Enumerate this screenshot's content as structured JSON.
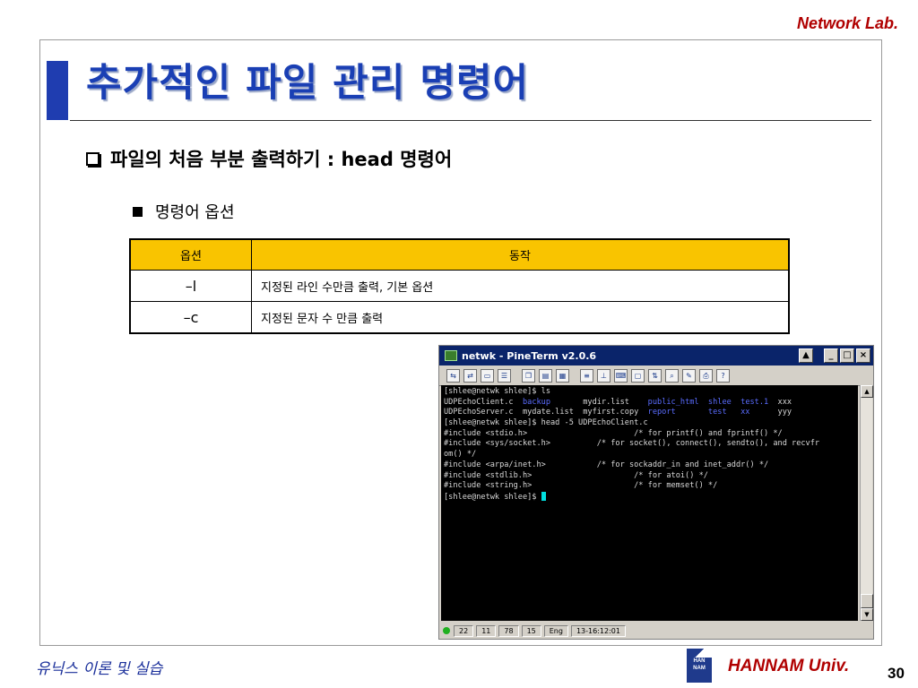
{
  "header": {
    "brand": "Network Lab."
  },
  "slide": {
    "title": "추가적인 파일 관리 명령어",
    "bullet1": "파일의 처음 부분 출력하기 : head 명령어",
    "bullet2": "명령어 옵션"
  },
  "options_table": {
    "headers": [
      "옵션",
      "동작"
    ],
    "rows": [
      {
        "option": "–l",
        "action": "지정된 라인 수만큼 출력, 기본 옵션"
      },
      {
        "option": "–c",
        "action": "지정된 문자 수 만큼 출력"
      }
    ]
  },
  "terminal": {
    "title": "netwk - PineTerm v2.0.6",
    "lines": {
      "l1": "[shlee@netwk shlee]$ ls",
      "l2a": "UDPEchoClient.c  ",
      "l2b": "backup",
      "l2c": "       mydir.list    ",
      "l2d": "public_html  shlee  test.1",
      "l2e": "  xxx",
      "l3a": "UDPEchoServer.c  mydate.list  myfirst.copy  ",
      "l3b": "report       test   xx",
      "l3c": "      yyy",
      "l4": "[shlee@netwk shlee]$ head -5 UDPEchoClient.c",
      "l5": "#include <stdio.h>                       /* for printf() and fprintf() */",
      "l6": "#include <sys/socket.h>          /* for socket(), connect(), sendto(), and recvfr",
      "l7": "om() */",
      "l8": "#include <arpa/inet.h>           /* for sockaddr_in and inet_addr() */",
      "l9": "#include <stdlib.h>                      /* for atoi() */",
      "l10": "#include <string.h>                      /* for memset() */",
      "l11": "[shlee@netwk shlee]$ "
    },
    "status": [
      "22",
      "11",
      "78",
      "15",
      "Eng",
      "13-16:12:01"
    ]
  },
  "footer": {
    "course": "유닉스 이론 및 실습",
    "logo_text": "HAN NAM",
    "brand": "HANNAM Univ.",
    "page": "30"
  }
}
